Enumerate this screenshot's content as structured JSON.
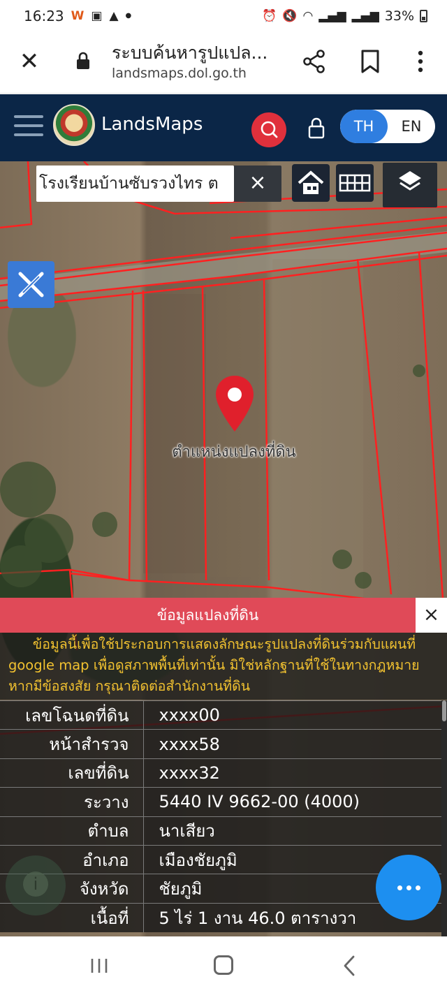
{
  "status_bar": {
    "time": "16:23",
    "battery": "33%"
  },
  "browser": {
    "title": "ระบบค้นหารูปแปล...",
    "url": "landsmaps.dol.go.th",
    "close_icon": "close-icon",
    "share_icon": "share-icon",
    "bookmark_icon": "bookmark-icon",
    "menu_icon": "more-vertical-icon"
  },
  "header": {
    "brand": "LandsMaps",
    "lang_th": "TH",
    "lang_en": "EN",
    "accent": "#2f7ee0",
    "search_color": "#e0303c"
  },
  "map": {
    "search_value": "โรงเรียนบ้านซับรวงไทร ต",
    "clear_label": "×",
    "pin_label": "ตำแหน่งแปลงที่ดิน"
  },
  "info": {
    "title": "ข้อมูลแปลงที่ดิน",
    "close_label": "×",
    "notice_line1": "ข้อมูลนี้เพื่อใช้ประกอบการแสดงลักษณะรูปแปลงที่ดินร่วมกับแผนที่",
    "notice_line2": "google map เพื่อดูสภาพพื้นที่เท่านั้น มิใช่หลักฐานที่ใช้ในทางกฎหมาย",
    "notice_line3": "หากมีข้อสงสัย กรุณาติดต่อสำนักงานที่ดิน",
    "rows": [
      {
        "key": "เลขโฉนดที่ดิน",
        "value": "xxxx00"
      },
      {
        "key": "หน้าสำรวจ",
        "value": "xxxx58"
      },
      {
        "key": "เลขที่ดิน",
        "value": "xxxx32"
      },
      {
        "key": "ระวาง",
        "value": "5440 IV 9662-00 (4000)"
      },
      {
        "key": "ตำบล",
        "value": "นาเสียว"
      },
      {
        "key": "อำเภอ",
        "value": "เมืองชัยภูมิ"
      },
      {
        "key": "จังหวัด",
        "value": "ชัยภูมิ"
      },
      {
        "key": "เนื้อที่",
        "value": "5 ไร่ 1 งาน 46.0 ตารางวา"
      }
    ]
  }
}
